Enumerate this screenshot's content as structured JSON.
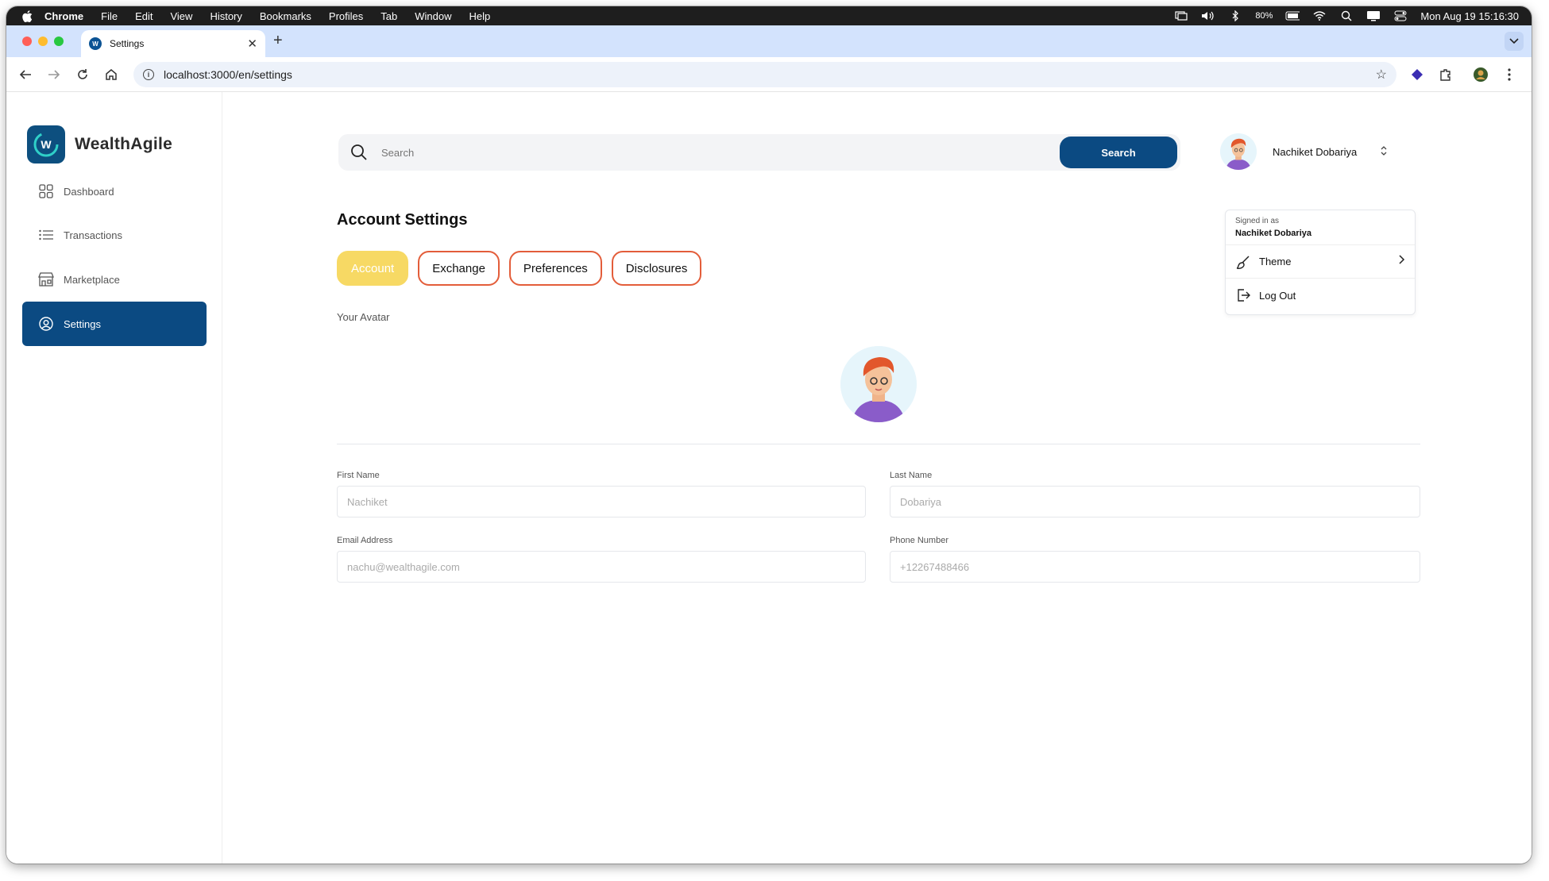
{
  "menubar": {
    "app": "Chrome",
    "items": [
      "File",
      "Edit",
      "View",
      "History",
      "Bookmarks",
      "Profiles",
      "Tab",
      "Window",
      "Help"
    ],
    "battery": "80%",
    "clock": "Mon Aug 19  15:16:30"
  },
  "browser": {
    "tab_title": "Settings",
    "url": "localhost:3000/en/settings"
  },
  "sidebar": {
    "brand": "WealthAgile",
    "items": [
      {
        "label": "Dashboard"
      },
      {
        "label": "Transactions"
      },
      {
        "label": "Marketplace"
      },
      {
        "label": "Settings"
      }
    ]
  },
  "header": {
    "search_placeholder": "Search",
    "search_button": "Search",
    "user_name": "Nachiket Dobariya"
  },
  "user_menu": {
    "signed_in_label": "Signed in as",
    "signed_in_name": "Nachiket Dobariya",
    "theme": "Theme",
    "logout": "Log Out"
  },
  "page": {
    "title": "Account Settings",
    "tabs": [
      "Account",
      "Exchange",
      "Preferences",
      "Disclosures"
    ],
    "avatar_label": "Your Avatar"
  },
  "form": {
    "first_name_label": "First Name",
    "first_name_value": "Nachiket",
    "last_name_label": "Last Name",
    "last_name_value": "Dobariya",
    "email_label": "Email Address",
    "email_value": "nachu@wealthagile.com",
    "phone_label": "Phone Number",
    "phone_value": "+12267488466"
  },
  "colors": {
    "primary": "#0b4a82",
    "active_tab": "#f7d964",
    "tab_border": "#e35d3a"
  }
}
